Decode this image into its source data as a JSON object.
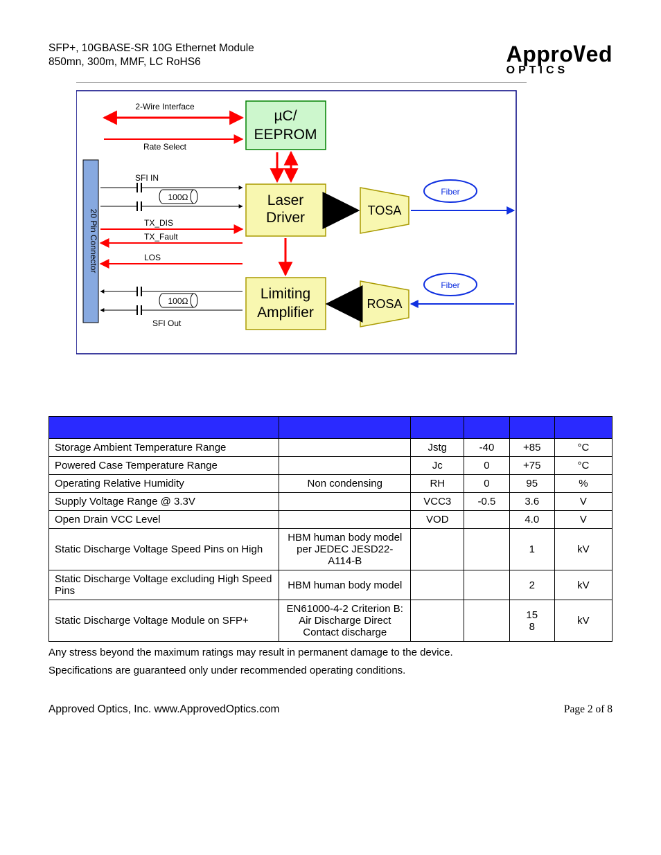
{
  "header": {
    "line1": "SFP+, 10GBASE-SR 10G Ethernet Module",
    "line2": "850mn, 300m, MMF, LC RoHS6"
  },
  "logo": {
    "top": "Approved",
    "bottom": "OPTICS"
  },
  "diagram": {
    "connector": "20 Pin Connector",
    "two_wire": "2-Wire Interface",
    "rate_select": "Rate Select",
    "sfi_in": "SFI IN",
    "ohm_top": "100Ω",
    "tx_dis": "TX_DIS",
    "tx_fault": "TX_Fault",
    "los": "LOS",
    "ohm_bot": "100Ω",
    "sfi_out": "SFI Out",
    "eeprom_l1": "µC/",
    "eeprom_l2": "EEPROM",
    "laser_l1": "Laser",
    "laser_l2": "Driver",
    "limit_l1": "Limiting",
    "limit_l2": "Amplifier",
    "tosa": "TOSA",
    "rosa": "ROSA",
    "fiber_top": "Fiber",
    "fiber_bot": "Fiber"
  },
  "table": {
    "rows": [
      {
        "param": "Storage Ambient Temperature Range",
        "cond": "",
        "sym": "Jstg",
        "min": "-40",
        "max": "+85",
        "unit": "°C"
      },
      {
        "param": "Powered Case Temperature Range",
        "cond": "",
        "sym": "Jc",
        "min": "0",
        "max": "+75",
        "unit": "°C"
      },
      {
        "param": "Operating Relative Humidity",
        "cond": "Non condensing",
        "sym": "RH",
        "min": "0",
        "max": "95",
        "unit": "%"
      },
      {
        "param": "Supply Voltage Range @ 3.3V",
        "cond": "",
        "sym": "VCC3",
        "min": "-0.5",
        "max": "3.6",
        "unit": "V"
      },
      {
        "param": "Open Drain VCC Level",
        "cond": "",
        "sym": "VOD",
        "min": "",
        "max": "4.0",
        "unit": "V"
      },
      {
        "param": "Static Discharge Voltage Speed Pins on High",
        "cond": "HBM human body model per JEDEC JESD22-A114-B",
        "sym": "",
        "min": "",
        "max": "1",
        "unit": "kV"
      },
      {
        "param": "Static Discharge Voltage excluding High Speed Pins",
        "cond": "HBM human body model",
        "sym": "",
        "min": "",
        "max": "2",
        "unit": "kV"
      },
      {
        "param": "Static Discharge Voltage Module on SFP+",
        "cond": "EN61000-4-2 Criterion B: Air Discharge Direct Contact discharge",
        "sym": "",
        "min": "",
        "max": "15\n8",
        "unit": "kV"
      }
    ]
  },
  "notes": {
    "l1": "Any stress beyond the maximum ratings may result in permanent damage to the device.",
    "l2": "Specifications are guaranteed only under recommended operating conditions."
  },
  "footer": {
    "left": "Approved Optics, Inc.  www.ApprovedOptics.com",
    "right": "Page 2 of 8"
  }
}
